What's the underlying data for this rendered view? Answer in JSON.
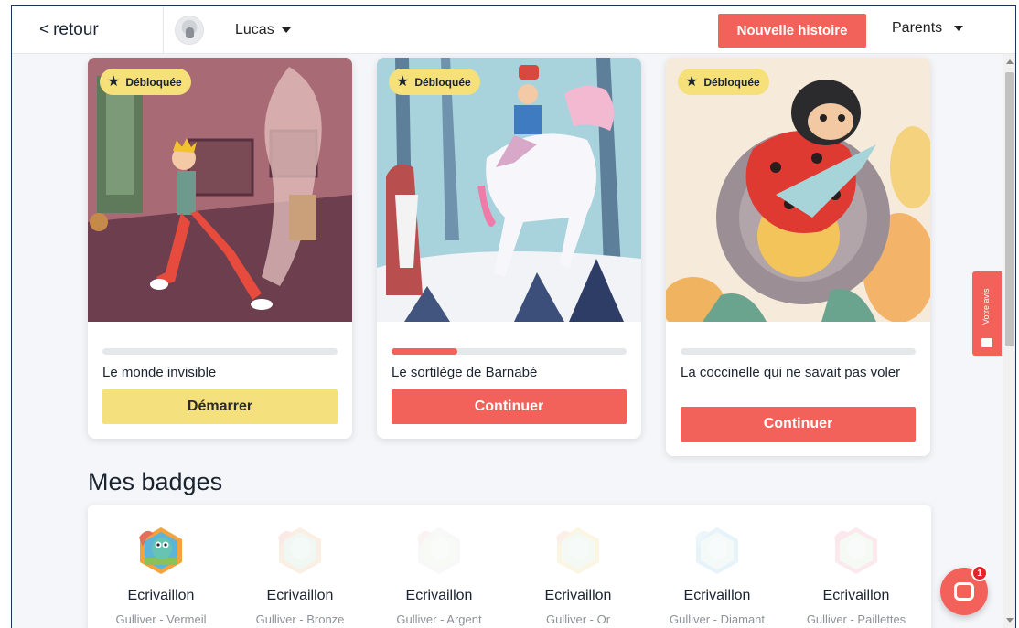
{
  "topbar": {
    "back_label": "retour",
    "user_name": "Lucas",
    "new_story_label": "Nouvelle histoire",
    "parents_label": "Parents"
  },
  "stories": [
    {
      "badge": "Débloquée",
      "title": "Le monde invisible",
      "progress": 0,
      "button": "Démarrer",
      "button_style": "yellow"
    },
    {
      "badge": "Débloquée",
      "title": "Le sortilège de Barnabé",
      "progress": 0.28,
      "button": "Continuer",
      "button_style": "red"
    },
    {
      "badge": "Débloquée",
      "title": "La coccinelle qui ne savait pas voler",
      "progress": 0,
      "button": "Continuer",
      "button_style": "red"
    }
  ],
  "badges_section": {
    "title": "Mes badges",
    "items": [
      {
        "name": "Ecrivaillon",
        "level": "Gulliver - Vermeil",
        "unlocked": true
      },
      {
        "name": "Ecrivaillon",
        "level": "Gulliver - Bronze",
        "unlocked": false
      },
      {
        "name": "Ecrivaillon",
        "level": "Gulliver - Argent",
        "unlocked": false
      },
      {
        "name": "Ecrivaillon",
        "level": "Gulliver - Or",
        "unlocked": false
      },
      {
        "name": "Ecrivaillon",
        "level": "Gulliver - Diamant",
        "unlocked": false
      },
      {
        "name": "Ecrivaillon",
        "level": "Gulliver - Paillettes",
        "unlocked": false
      }
    ]
  },
  "feedback_tab": {
    "label": "Votre avis"
  },
  "chat": {
    "unread_count": "1"
  },
  "colors": {
    "accent": "#f3625a",
    "yellow": "#f4e07d",
    "text": "#1a2330"
  }
}
